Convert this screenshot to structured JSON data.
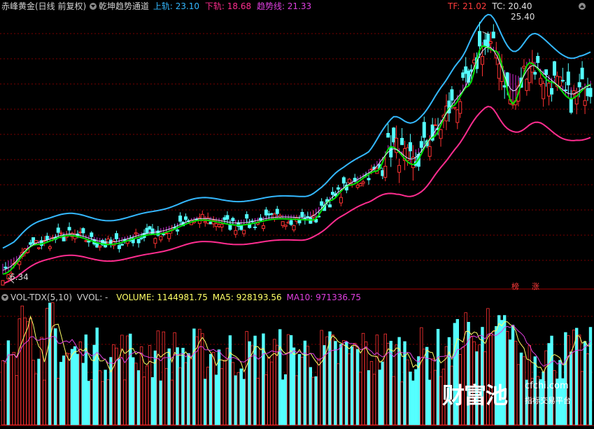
{
  "main_header": {
    "stock_label": "赤峰黄金(日线 前复权)",
    "indicator_name": "乾坤趋势通道",
    "upper_label": "上轨: 23.10",
    "lower_label": "下轨: 18.68",
    "trend_label": "趋势线: 21.33",
    "tf_label": "TF: 21.02",
    "tc_label": "TC: 20.40"
  },
  "vol_header": {
    "name": "VOL-TDX(5,10)",
    "vvol": "VVOL: -",
    "volume": "VOLUME: 1144981.75",
    "ma5": "MA5: 928193.56",
    "ma10": "MA10: 971336.75"
  },
  "annotations": {
    "high": "25.40",
    "low": "6.34",
    "tag1": "榜",
    "tag2": "涨"
  },
  "watermark": {
    "big": "财富池",
    "site": "cfchi.com",
    "sub": "指标交易平台"
  },
  "colors": {
    "up": "#ff3232",
    "down": "#54ffff",
    "upper": "#34b8ff",
    "lower": "#ff2d8f",
    "trend": "#00e000",
    "fill": "#d12bd6",
    "ma5": "#ffff66",
    "ma10": "#e040e0",
    "grid": "#7a0000"
  },
  "chart_data": {
    "type": "candlestick",
    "ylim_price": [
      5.5,
      27.0
    ],
    "close_start": 6.6,
    "close_end": 21.33,
    "high_price": 25.4,
    "low_price": 6.34,
    "trend_anchors": [
      [
        0,
        6.6
      ],
      [
        12,
        8.9
      ],
      [
        24,
        9.6
      ],
      [
        38,
        8.9
      ],
      [
        55,
        9.7
      ],
      [
        72,
        10.8
      ],
      [
        85,
        10.4
      ],
      [
        100,
        10.9
      ],
      [
        112,
        10.8
      ],
      [
        118,
        12.3
      ],
      [
        125,
        13.5
      ],
      [
        135,
        14.6
      ],
      [
        140,
        16.5
      ],
      [
        148,
        15.1
      ],
      [
        155,
        17.2
      ],
      [
        162,
        19.6
      ],
      [
        168,
        21.2
      ],
      [
        173,
        24.3
      ],
      [
        178,
        23.9
      ],
      [
        184,
        19.8
      ],
      [
        190,
        23.0
      ],
      [
        198,
        21.5
      ],
      [
        205,
        20.2
      ],
      [
        212,
        21.3
      ]
    ],
    "upper_offset": 1.7,
    "lower_offset_ratio": 0.13,
    "volume_last": 1144981.75,
    "volume_ma5": 928193.56,
    "volume_ma10": 971336.75
  }
}
